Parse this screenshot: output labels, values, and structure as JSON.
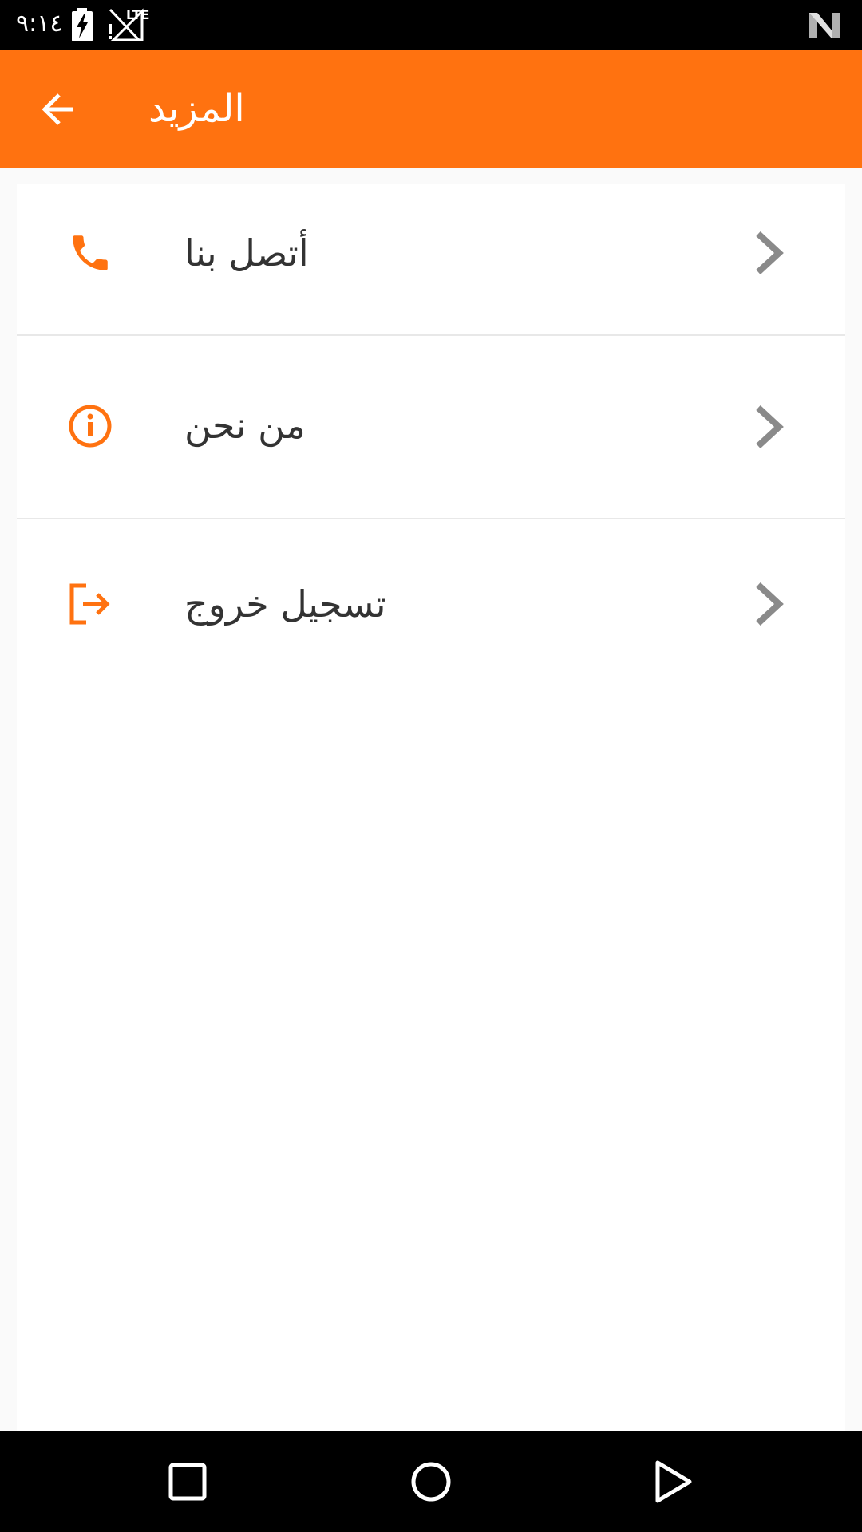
{
  "status_bar": {
    "time": "٩:١٤",
    "network_label": "LTE",
    "icons": [
      "battery-charging-icon",
      "signal-no-service-icon",
      "n-logo-icon"
    ]
  },
  "app_bar": {
    "title": "المزيد",
    "back_icon": "arrow-back-icon"
  },
  "menu": {
    "items": [
      {
        "label": "أتصل بنا",
        "icon": "phone-icon",
        "chevron": "chevron-right-icon"
      },
      {
        "label": "من نحن",
        "icon": "info-icon",
        "chevron": "chevron-right-icon"
      },
      {
        "label": "تسجيل خروج",
        "icon": "logout-icon",
        "chevron": "chevron-right-icon"
      }
    ]
  },
  "nav_bar": {
    "icons": [
      "recents-square-icon",
      "home-circle-icon",
      "back-triangle-icon"
    ]
  },
  "colors": {
    "accent": "#ff7210",
    "status_bar": "#000000",
    "nav_bar": "#000000",
    "background": "#fafafa",
    "card": "#ffffff",
    "chevron": "#8a8a8a",
    "text": "#333333"
  }
}
